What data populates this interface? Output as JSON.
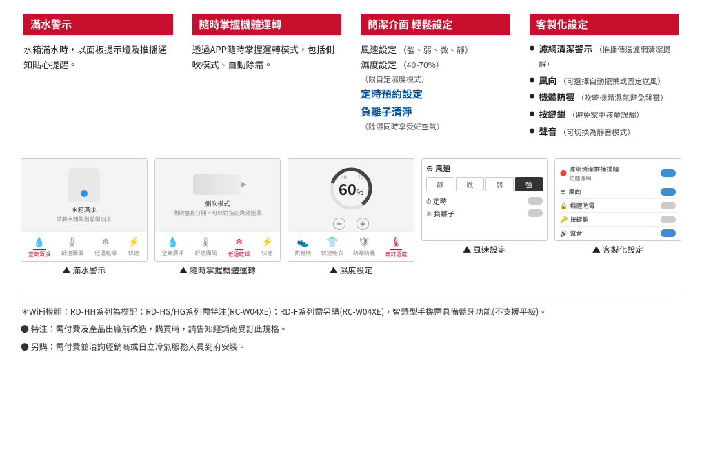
{
  "features": [
    {
      "id": "full-water",
      "header": "滿水警示",
      "body": "水箱滿水時，以面板提示燈及推播通知貼心提醒。",
      "type": "text"
    },
    {
      "id": "remote-control",
      "header": "隨時掌握機體運轉",
      "body": "透過APP隨時掌握運轉模式，包括側吹模式、自動除霜。",
      "type": "text"
    },
    {
      "id": "simple-ui",
      "header": "簡潔介面 輕鬆設定",
      "items": [
        {
          "text": "風速設定",
          "paren": "（強、弱、微、靜）",
          "highlight": false
        },
        {
          "text": "濕度設定",
          "paren": "（40-70%）",
          "highlight": false
        },
        {
          "text": "（限自定濕度模式）",
          "paren": "",
          "sub": true
        },
        {
          "text": "定時預約設定",
          "paren": "",
          "highlight": true
        },
        {
          "text": "負離子清淨",
          "paren": "",
          "highlight": true
        },
        {
          "text": "（除濕同時享受好空氣）",
          "paren": "",
          "sub": true
        }
      ],
      "type": "list-special"
    },
    {
      "id": "custom-settings",
      "header": "客製化設定",
      "items": [
        {
          "text": "濾網清潔警示",
          "paren": "（推播傳送濾網清潔提醒）"
        },
        {
          "text": "風向",
          "paren": "（可選擇自動擺葉或固定送風）"
        },
        {
          "text": "機體防霉",
          "paren": "（吹乾機體濕氣避免發霉）"
        },
        {
          "text": "按鍵鎖",
          "paren": "（避免家中孩童誤觸）"
        },
        {
          "text": "聲音",
          "paren": "（可切換為靜音模式）"
        }
      ],
      "type": "bullet-list"
    }
  ],
  "screenshots": [
    {
      "id": "full-water-screen",
      "label": "▲ 滿水警示",
      "caption_main": "水箱滿水",
      "caption_sub": "請將水箱取出並倒出水",
      "tabs": [
        "空氣清淨",
        "舒適團風",
        "低溫乾燥",
        "快速"
      ]
    },
    {
      "id": "remote-screen",
      "label": "▲ 隨時掌握機體運轉",
      "caption_main": "側吹模式",
      "caption_sub": "側吹墓直打開，可針對指定角落送風",
      "tabs": [
        "空氣清淨",
        "舒適團風",
        "低溫乾燥",
        "快速"
      ]
    },
    {
      "id": "humidity-screen",
      "label": "▲ 濕度設定",
      "value": "60",
      "unit": "%",
      "tabs": [
        "烘鞋機",
        "快速乾衣",
        "防霉防蟲",
        "自訂溫度"
      ]
    },
    {
      "id": "wind-screen",
      "label": "▲ 風速設定",
      "wind_title": "風速",
      "wind_buttons": [
        "靜",
        "微",
        "弱",
        "強"
      ],
      "toggles": [
        {
          "label": "定時",
          "on": false
        },
        {
          "label": "負離子",
          "on": false
        }
      ]
    },
    {
      "id": "custom-screen",
      "label": "▲ 客製化設定",
      "rows": [
        {
          "label": "濾網清潔推播提醒",
          "sub": "防塵濾網",
          "on": true
        },
        {
          "label": "風向",
          "on": true
        },
        {
          "label": "機體防霉",
          "on": false
        },
        {
          "label": "按鍵鎖",
          "on": false
        },
        {
          "label": "聲音",
          "on": true
        }
      ]
    }
  ],
  "footer": {
    "line1": "＊WiFi模組：RD-HH系列為標配；RD-HS/HG系列需特注(RC-W04XE)；RD-F系列需另購(RC-W04XE)，智慧型手機需具備藍牙功能(不支援平板)。",
    "line2": "● 特注：需付費及產品出廠前改造，購買時，請告知經銷商受訂此規格。",
    "line3": "● 另購：需付費並洽詢經銷商或日立冷氣服務人員到府安裝。"
  }
}
